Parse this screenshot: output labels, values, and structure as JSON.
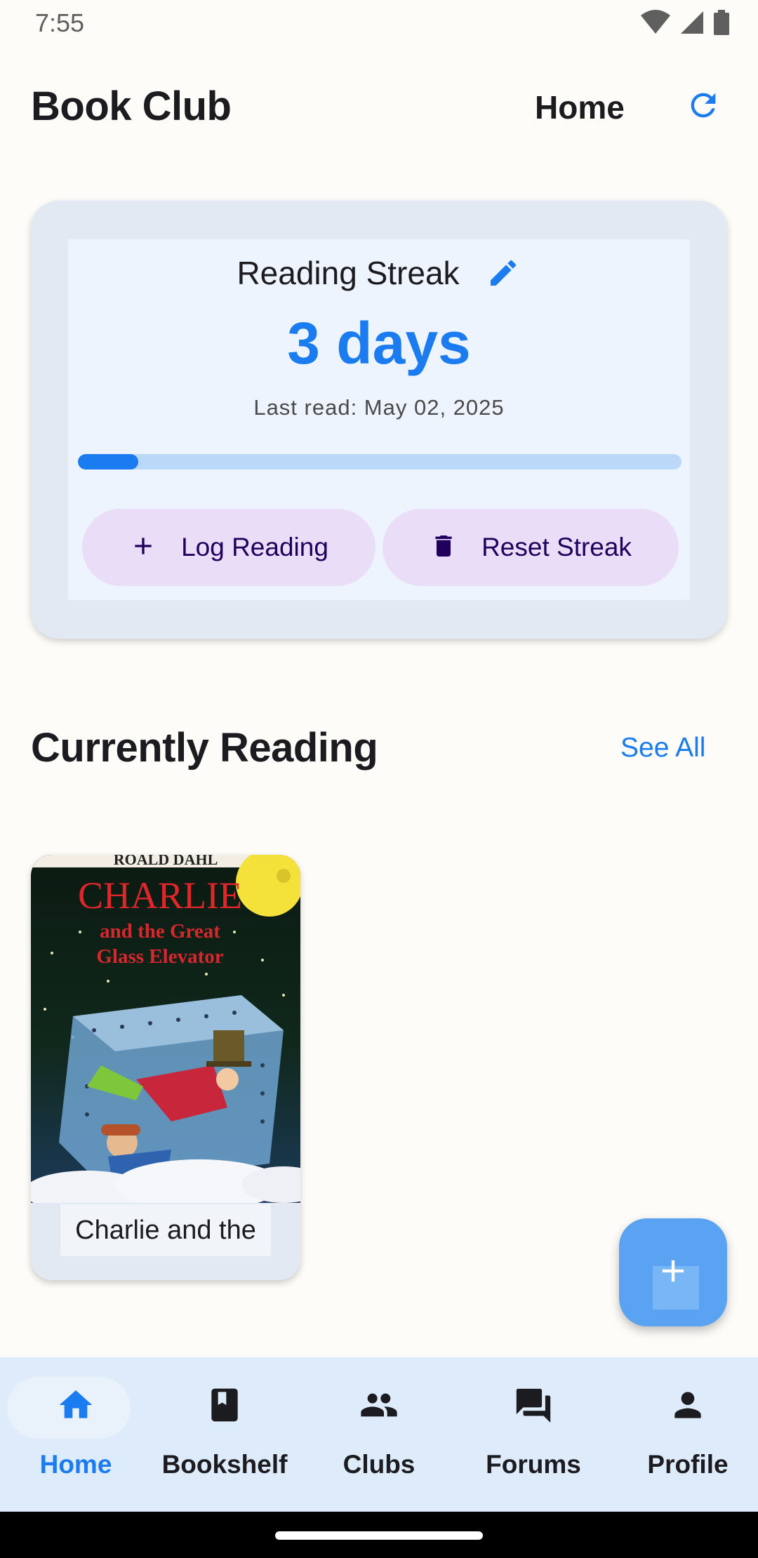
{
  "status_bar": {
    "time": "7:55",
    "icons": [
      "wifi-icon",
      "signal-icon",
      "battery-icon"
    ]
  },
  "app_bar": {
    "title": "Book Club",
    "section": "Home",
    "refresh_icon": "refresh-icon"
  },
  "streak": {
    "title": "Reading Streak",
    "count": "3 days",
    "last_read": "Last read: May 02, 2025",
    "progress_fraction": 0.1,
    "log_button": "Log Reading",
    "reset_button": "Reset Streak"
  },
  "currently_reading": {
    "title": "Currently Reading",
    "see_all": "See All",
    "books": [
      {
        "title": "Charlie and the",
        "cover_text": {
          "author": "ROALD DAHL",
          "line1": "CHARLIE",
          "line2": "and the Great",
          "line3": "Glass Elevator"
        }
      }
    ]
  },
  "fab": {
    "icon": "plus-icon"
  },
  "bottom_nav": {
    "items": [
      {
        "label": "Home",
        "icon": "home-icon",
        "active": true
      },
      {
        "label": "Bookshelf",
        "icon": "book-icon",
        "active": false
      },
      {
        "label": "Clubs",
        "icon": "group-icon",
        "active": false
      },
      {
        "label": "Forums",
        "icon": "forum-icon",
        "active": false
      },
      {
        "label": "Profile",
        "icon": "person-icon",
        "active": false
      }
    ]
  },
  "colors": {
    "accent": "#1A7CF0",
    "button_bg": "#EADDF8",
    "nav_bg": "#DDEBFB"
  }
}
